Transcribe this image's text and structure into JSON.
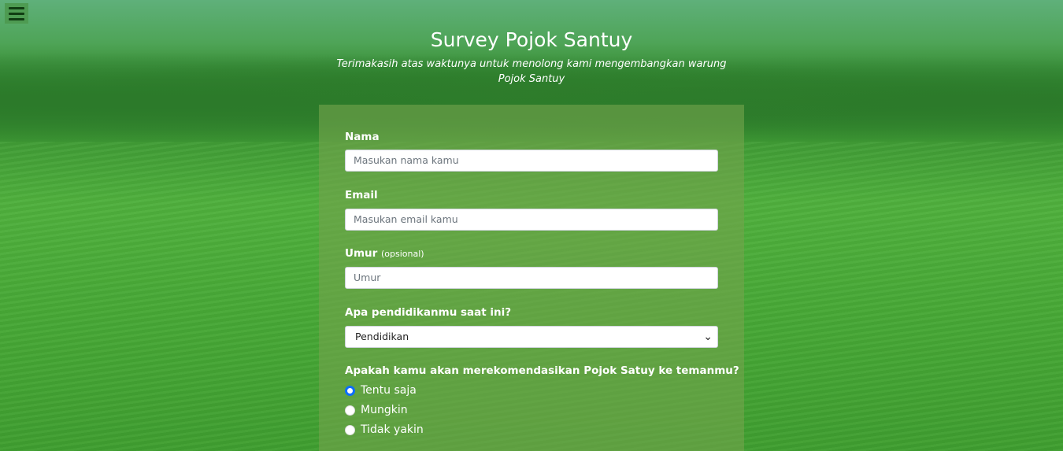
{
  "header": {
    "title": "Survey Pojok Santuy",
    "subtitle_line1": "Terimakasih atas waktunya untuk menolong kami mengembangkan warung",
    "subtitle_line2": "Pojok Santuy"
  },
  "form": {
    "nama": {
      "label": "Nama",
      "placeholder": "Masukan nama kamu"
    },
    "email": {
      "label": "Email",
      "placeholder": "Masukan email kamu"
    },
    "umur": {
      "label": "Umur",
      "note": "(opsional)",
      "placeholder": "Umur"
    },
    "pendidikan": {
      "label": "Apa pendidikanmu saat ini?",
      "selected": "Pendidikan"
    },
    "rekomendasi": {
      "label": "Apakah kamu akan merekomendasikan Pojok Satuy ke temanmu?",
      "options": [
        "Tentu saja",
        "Mungkin",
        "Tidak yakin"
      ],
      "selected_index": 0
    }
  },
  "icons": {
    "menu": "hamburger-menu-icon",
    "select": "chevron-down-icon"
  },
  "colors": {
    "accent": "#0d6efd",
    "menu_bar": "#103d12"
  }
}
